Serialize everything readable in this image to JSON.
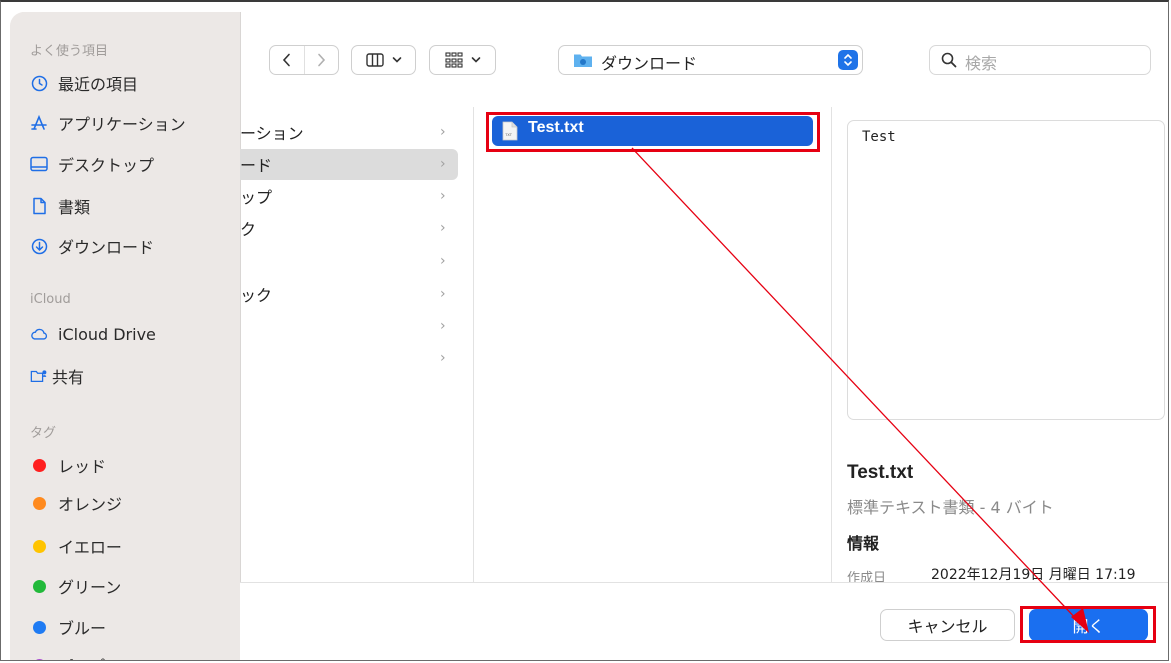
{
  "sidebar": {
    "favorites_heading": "よく使う項目",
    "favorites": [
      {
        "label": "最近の項目",
        "icon": "clock-icon"
      },
      {
        "label": "アプリケーション",
        "icon": "apps-icon"
      },
      {
        "label": "デスクトップ",
        "icon": "desktop-icon"
      },
      {
        "label": "書類",
        "icon": "document-icon"
      },
      {
        "label": "ダウンロード",
        "icon": "download-icon"
      }
    ],
    "icloud_heading": "iCloud",
    "icloud": [
      {
        "label": "iCloud Drive",
        "icon": "cloud-icon"
      },
      {
        "label": "共有",
        "icon": "shared-folder-icon"
      }
    ],
    "tags_heading": "タグ",
    "tags": [
      {
        "label": "レッド",
        "color": "#ff1f1f"
      },
      {
        "label": "オレンジ",
        "color": "#ff8a1e"
      },
      {
        "label": "イエロー",
        "color": "#ffc400"
      },
      {
        "label": "グリーン",
        "color": "#22b93a"
      },
      {
        "label": "ブルー",
        "color": "#1f7bf3"
      },
      {
        "label": "パープル",
        "color": "#a94ecf"
      }
    ]
  },
  "toolbar": {
    "location": "ダウンロード",
    "search_placeholder": "検索"
  },
  "column1": {
    "rows": [
      {
        "label": "ーション"
      },
      {
        "label": "ード"
      },
      {
        "label": "ップ"
      },
      {
        "label": "ク"
      },
      {
        "label": ""
      },
      {
        "label": "ック"
      },
      {
        "label": ""
      },
      {
        "label": ""
      }
    ]
  },
  "column2": {
    "selected_file": "Test.txt"
  },
  "preview": {
    "content": "Test",
    "filename": "Test.txt",
    "kind": "標準テキスト書類 - 4 バイト",
    "info_heading": "情報",
    "created_label": "作成日",
    "created_value": "2022年12月19日 月曜日 17:19"
  },
  "buttons": {
    "cancel": "キャンセル",
    "open": "開く"
  },
  "colors": {
    "selection": "#1a62d8",
    "annotation": "#e60012"
  }
}
